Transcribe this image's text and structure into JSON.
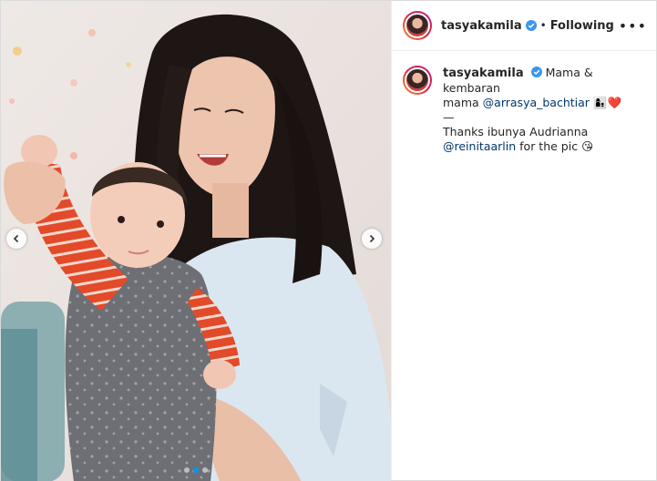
{
  "post": {
    "username": "tasyakamila",
    "following_label": "Following",
    "more_label": "•••",
    "separator": "•",
    "caption": {
      "text_1": "Mama & kembaran",
      "text_2": "mama",
      "mention_1": "@arrasya_bachtiar",
      "emoji_1": "👩‍👦❤️",
      "divider": "—",
      "text_3": "Thanks ibunya Audrianna",
      "mention_2": "@reinitaarlin",
      "text_4": "for the pic",
      "emoji_2": "😘"
    },
    "carousel": {
      "count": 3,
      "active": 1
    }
  },
  "colors": {
    "link": "#00376b",
    "verified": "#3897f0",
    "active_dot": "#0095f6"
  }
}
